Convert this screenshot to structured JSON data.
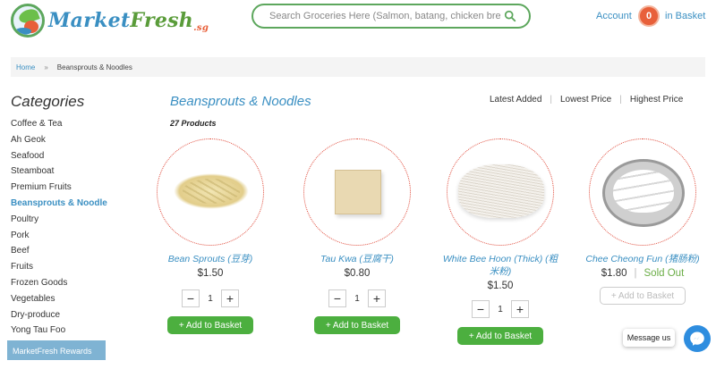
{
  "header": {
    "logo_text_market": "Market",
    "logo_text_fresh": "Fresh",
    "logo_text_sg": ".sg",
    "search_placeholder": "Search Groceries Here (Salmon, batang, chicken breast...)",
    "account_label": "Account",
    "basket_count": "0",
    "basket_label": "in Basket"
  },
  "breadcrumb": {
    "home": "Home",
    "separator": "»",
    "current": "Beansprouts & Noodles"
  },
  "sidebar": {
    "title": "Categories",
    "items": [
      {
        "label": "Coffee & Tea"
      },
      {
        "label": "Ah Geok"
      },
      {
        "label": "Seafood"
      },
      {
        "label": "Steamboat"
      },
      {
        "label": "Premium Fruits"
      },
      {
        "label": "Beansprouts & Noodle"
      },
      {
        "label": "Poultry"
      },
      {
        "label": "Pork"
      },
      {
        "label": "Beef"
      },
      {
        "label": "Fruits"
      },
      {
        "label": "Frozen Goods"
      },
      {
        "label": "Vegetables"
      },
      {
        "label": "Dry-produce"
      },
      {
        "label": "Yong Tau Foo"
      }
    ],
    "active_index": 5
  },
  "rewards": {
    "label": "MarketFresh Rewards"
  },
  "main": {
    "title": "Beansprouts & Noodles",
    "product_count": "27 Products",
    "sort": {
      "latest": "Latest Added",
      "divider": "|",
      "lowest": "Lowest Price",
      "highest": "Highest Price"
    },
    "products": [
      {
        "name": "Bean Sprouts (豆芽)",
        "price": "$1.50",
        "qty": "1",
        "add_label": "+ Add to Basket",
        "sold_out": ""
      },
      {
        "name": "Tau Kwa (豆腐干)",
        "price": "$0.80",
        "qty": "1",
        "add_label": "+ Add to Basket",
        "sold_out": ""
      },
      {
        "name": "White Bee Hoon (Thick) (粗米粉)",
        "price": "$1.50",
        "qty": "1",
        "add_label": "+ Add to Basket",
        "sold_out": ""
      },
      {
        "name": "Chee Cheong Fun (猪肠粉)",
        "price": "$1.80",
        "qty": "",
        "add_label": "+ Add to Basket",
        "sold_out": "Sold Out",
        "sold_sep": "|"
      }
    ],
    "qty_minus": "−",
    "qty_plus": "+"
  },
  "chat": {
    "message_us": "Message us"
  },
  "colors": {
    "brand_blue": "#3a8fc2",
    "brand_green": "#4caf3f",
    "accent_orange": "#e8603a",
    "dotted_red": "#e04a3a"
  }
}
